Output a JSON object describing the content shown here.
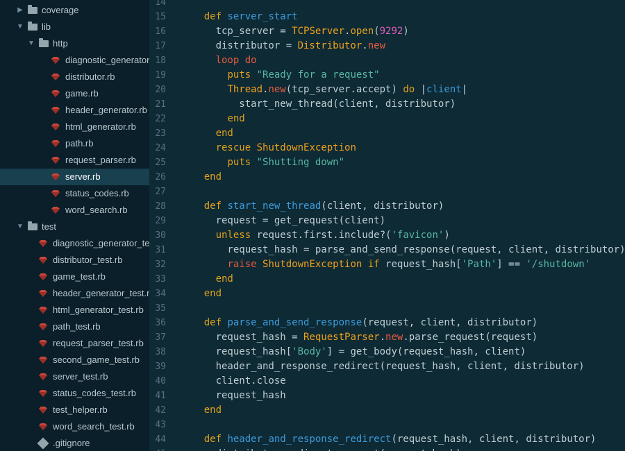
{
  "sidebar": {
    "items": [
      {
        "type": "folder",
        "label": "coverage",
        "level": 0,
        "expanded": false,
        "selected": false
      },
      {
        "type": "folder",
        "label": "lib",
        "level": 0,
        "expanded": true,
        "selected": false
      },
      {
        "type": "folder",
        "label": "http",
        "level": 1,
        "expanded": true,
        "selected": false
      },
      {
        "type": "ruby",
        "label": "diagnostic_generator.rb",
        "level": 2,
        "selected": false
      },
      {
        "type": "ruby",
        "label": "distributor.rb",
        "level": 2,
        "selected": false
      },
      {
        "type": "ruby",
        "label": "game.rb",
        "level": 2,
        "selected": false
      },
      {
        "type": "ruby",
        "label": "header_generator.rb",
        "level": 2,
        "selected": false
      },
      {
        "type": "ruby",
        "label": "html_generator.rb",
        "level": 2,
        "selected": false
      },
      {
        "type": "ruby",
        "label": "path.rb",
        "level": 2,
        "selected": false
      },
      {
        "type": "ruby",
        "label": "request_parser.rb",
        "level": 2,
        "selected": false
      },
      {
        "type": "ruby",
        "label": "server.rb",
        "level": 2,
        "selected": true
      },
      {
        "type": "ruby",
        "label": "status_codes.rb",
        "level": 2,
        "selected": false
      },
      {
        "type": "ruby",
        "label": "word_search.rb",
        "level": 2,
        "selected": false
      },
      {
        "type": "folder",
        "label": "test",
        "level": 0,
        "expanded": true,
        "selected": false
      },
      {
        "type": "ruby",
        "label": "diagnostic_generator_test.rb",
        "level": 1,
        "selected": false
      },
      {
        "type": "ruby",
        "label": "distributor_test.rb",
        "level": 1,
        "selected": false
      },
      {
        "type": "ruby",
        "label": "game_test.rb",
        "level": 1,
        "selected": false
      },
      {
        "type": "ruby",
        "label": "header_generator_test.rb",
        "level": 1,
        "selected": false
      },
      {
        "type": "ruby",
        "label": "html_generator_test.rb",
        "level": 1,
        "selected": false
      },
      {
        "type": "ruby",
        "label": "path_test.rb",
        "level": 1,
        "selected": false
      },
      {
        "type": "ruby",
        "label": "request_parser_test.rb",
        "level": 1,
        "selected": false
      },
      {
        "type": "ruby",
        "label": "second_game_test.rb",
        "level": 1,
        "selected": false
      },
      {
        "type": "ruby",
        "label": "server_test.rb",
        "level": 1,
        "selected": false
      },
      {
        "type": "ruby",
        "label": "status_codes_test.rb",
        "level": 1,
        "selected": false
      },
      {
        "type": "ruby",
        "label": "test_helper.rb",
        "level": 1,
        "selected": false
      },
      {
        "type": "ruby",
        "label": "word_search_test.rb",
        "level": 1,
        "selected": false
      },
      {
        "type": "git",
        "label": ".gitignore",
        "level": 1,
        "selected": false
      }
    ]
  },
  "editor": {
    "first_visible_line_number": "14",
    "lines": [
      {
        "n": "15",
        "t": [
          [
            "    ",
            ""
          ],
          [
            "def ",
            "kw"
          ],
          [
            "server_start",
            "fn"
          ]
        ]
      },
      {
        "n": "16",
        "t": [
          [
            "      tcp_server = ",
            ""
          ],
          [
            "TCPServer",
            "cls"
          ],
          [
            ".",
            ""
          ],
          [
            "open",
            "kw"
          ],
          [
            "(",
            ""
          ],
          [
            "9292",
            "num"
          ],
          [
            ")",
            ""
          ]
        ]
      },
      {
        "n": "17",
        "t": [
          [
            "      distributor = ",
            ""
          ],
          [
            "Distributor",
            "cls"
          ],
          [
            ".",
            ""
          ],
          [
            "new",
            "kwr"
          ]
        ]
      },
      {
        "n": "18",
        "t": [
          [
            "      ",
            ""
          ],
          [
            "loop do",
            "kwr"
          ]
        ]
      },
      {
        "n": "19",
        "t": [
          [
            "        ",
            ""
          ],
          [
            "puts ",
            "kw"
          ],
          [
            "\"Ready for a request\"",
            "str"
          ]
        ]
      },
      {
        "n": "20",
        "t": [
          [
            "        ",
            ""
          ],
          [
            "Thread",
            "cls"
          ],
          [
            ".",
            ""
          ],
          [
            "new",
            "kwr"
          ],
          [
            "(tcp_server.accept) ",
            ""
          ],
          [
            "do",
            "kw"
          ],
          [
            " |",
            ""
          ],
          [
            "client",
            "fn"
          ],
          [
            "|",
            ""
          ]
        ]
      },
      {
        "n": "21",
        "t": [
          [
            "          start_new_thread(client, distributor)",
            ""
          ]
        ]
      },
      {
        "n": "22",
        "t": [
          [
            "        ",
            ""
          ],
          [
            "end",
            "kw"
          ]
        ]
      },
      {
        "n": "23",
        "t": [
          [
            "      ",
            ""
          ],
          [
            "end",
            "kw"
          ]
        ]
      },
      {
        "n": "24",
        "t": [
          [
            "      ",
            ""
          ],
          [
            "rescue ",
            "kw"
          ],
          [
            "ShutdownException",
            "cls"
          ]
        ]
      },
      {
        "n": "25",
        "t": [
          [
            "        ",
            ""
          ],
          [
            "puts ",
            "kw"
          ],
          [
            "\"Shutting down\"",
            "str"
          ]
        ]
      },
      {
        "n": "26",
        "t": [
          [
            "    ",
            ""
          ],
          [
            "end",
            "kw"
          ]
        ]
      },
      {
        "n": "27",
        "t": []
      },
      {
        "n": "28",
        "t": [
          [
            "    ",
            ""
          ],
          [
            "def ",
            "kw"
          ],
          [
            "start_new_thread",
            "fn"
          ],
          [
            "(client, distributor)",
            ""
          ]
        ]
      },
      {
        "n": "29",
        "t": [
          [
            "      request = get_request(client)",
            ""
          ]
        ]
      },
      {
        "n": "30",
        "t": [
          [
            "      ",
            ""
          ],
          [
            "unless ",
            "kw"
          ],
          [
            "request.first.include?(",
            ""
          ],
          [
            "'favicon'",
            "str"
          ],
          [
            ")",
            ""
          ]
        ]
      },
      {
        "n": "31",
        "t": [
          [
            "        request_hash = parse_and_send_response(request, client, distributor)",
            ""
          ]
        ]
      },
      {
        "n": "32",
        "t": [
          [
            "        ",
            ""
          ],
          [
            "raise ",
            "kwr"
          ],
          [
            "ShutdownException ",
            "cls"
          ],
          [
            "if ",
            "kw"
          ],
          [
            "request_hash[",
            ""
          ],
          [
            "'Path'",
            "str"
          ],
          [
            "] == ",
            ""
          ],
          [
            "'/shutdown'",
            "str"
          ]
        ]
      },
      {
        "n": "33",
        "t": [
          [
            "      ",
            ""
          ],
          [
            "end",
            "kw"
          ]
        ]
      },
      {
        "n": "34",
        "t": [
          [
            "    ",
            ""
          ],
          [
            "end",
            "kw"
          ]
        ]
      },
      {
        "n": "35",
        "t": []
      },
      {
        "n": "36",
        "t": [
          [
            "    ",
            ""
          ],
          [
            "def ",
            "kw"
          ],
          [
            "parse_and_send_response",
            "fn"
          ],
          [
            "(request, client, distributor)",
            ""
          ]
        ]
      },
      {
        "n": "37",
        "t": [
          [
            "      request_hash = ",
            ""
          ],
          [
            "RequestParser",
            "cls"
          ],
          [
            ".",
            ""
          ],
          [
            "new",
            "kwr"
          ],
          [
            ".parse_request(request)",
            ""
          ]
        ]
      },
      {
        "n": "38",
        "t": [
          [
            "      request_hash[",
            ""
          ],
          [
            "'Body'",
            "str"
          ],
          [
            "] = get_body(request_hash, client)",
            ""
          ]
        ]
      },
      {
        "n": "39",
        "t": [
          [
            "      header_and_response_redirect(request_hash, client, distributor)",
            ""
          ]
        ]
      },
      {
        "n": "40",
        "t": [
          [
            "      client.close",
            ""
          ]
        ]
      },
      {
        "n": "41",
        "t": [
          [
            "      request_hash",
            ""
          ]
        ]
      },
      {
        "n": "42",
        "t": [
          [
            "    ",
            ""
          ],
          [
            "end",
            "kw"
          ]
        ]
      },
      {
        "n": "43",
        "t": []
      },
      {
        "n": "44",
        "t": [
          [
            "    ",
            ""
          ],
          [
            "def ",
            "kw"
          ],
          [
            "header_and_response_redirect",
            "fn"
          ],
          [
            "(request_hash, client, distributor)",
            ""
          ]
        ]
      },
      {
        "n": "45",
        "t": [
          [
            "      distributor.redirect_request(request_hash)",
            ""
          ]
        ]
      }
    ]
  },
  "colors": {
    "sidebar_bg": "#0a1f29",
    "editor_bg": "#0e2a35",
    "selected_row_bg": "#18404f",
    "ruby_icon": "#c8473c",
    "keyword": "#e1a21b",
    "keyword_red": "#e85b3f",
    "function": "#3d9bdb",
    "string": "#58b8a4",
    "number": "#d85fb8"
  }
}
